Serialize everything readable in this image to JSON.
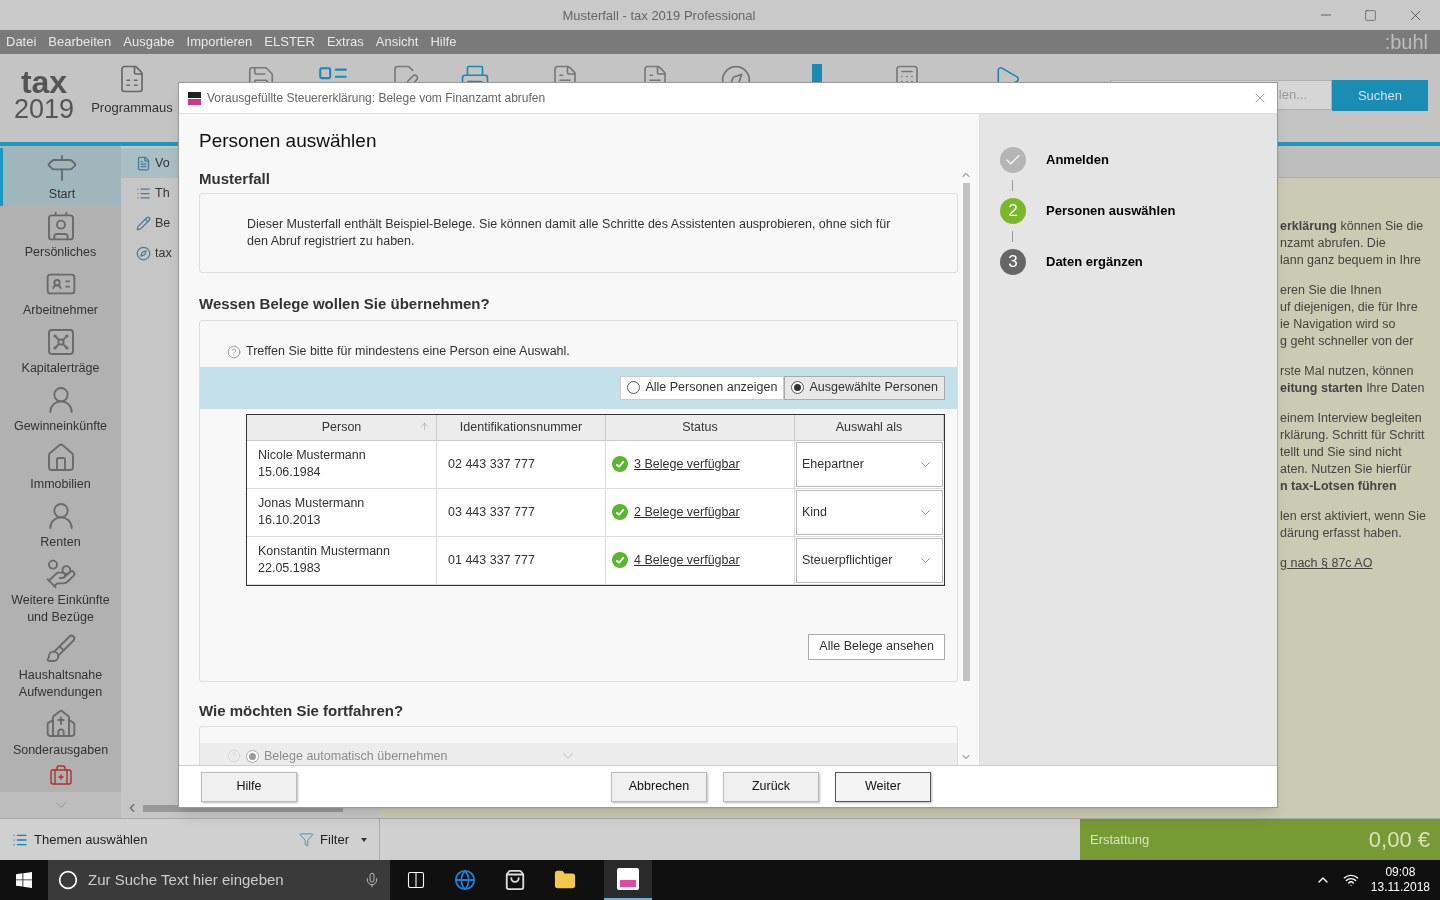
{
  "window": {
    "title": "Musterfall - tax 2019 Professional"
  },
  "menu": [
    "Datei",
    "Bearbeiten",
    "Ausgabe",
    "Importieren",
    "ELSTER",
    "Extras",
    "Ansicht",
    "Hilfe"
  ],
  "brand": ":buhl",
  "toolbar": {
    "logo_word": "tax",
    "logo_year": "2019",
    "program_label": "Programmaus",
    "search_placeholder": "len...",
    "search_button": "Suchen"
  },
  "nav": [
    {
      "label": "Start",
      "selected": true
    },
    {
      "label": "Persönliches",
      "selected": false
    },
    {
      "label": "Arbeitnehmer",
      "selected": false
    },
    {
      "label": "Kapitalerträge",
      "selected": false
    },
    {
      "label": "Gewinneinkünfte",
      "selected": false
    },
    {
      "label": "Immobilien",
      "selected": false
    },
    {
      "label": "Renten",
      "selected": false
    },
    {
      "label": "Weitere Einkünfte und Bezüge",
      "selected": false
    },
    {
      "label": "Haushaltsnahe Aufwendungen",
      "selected": false
    },
    {
      "label": "Sonderausgaben",
      "selected": false
    }
  ],
  "subnav": [
    {
      "label": "Vo",
      "selected": true
    },
    {
      "label": "Th",
      "selected": false
    },
    {
      "label": "Be",
      "selected": false
    },
    {
      "label": "tax",
      "selected": false
    }
  ],
  "info": {
    "paragraphs": [
      [
        "**erklärung** können Sie die",
        "nzamt abrufen. Die",
        "lann ganz bequem in Ihre"
      ],
      [
        "eren Sie die Ihnen",
        "uf diejenigen, die für Ihre",
        "ie Navigation wird so",
        "g geht schneller von der"
      ],
      [
        "rste Mal nutzen, können",
        "**eitung starten** Ihre Daten"
      ],
      [
        "einem Interview begleiten",
        "rklärung. Schritt für Schritt",
        "tellt und Sie sind nicht",
        "aten. Nutzen Sie hierfür",
        "**n tax-Lotsen führen**"
      ],
      [
        "len erst aktiviert, wenn Sie",
        "därung erfasst haben."
      ]
    ],
    "link": "g nach § 87c AO"
  },
  "bottom_bar": {
    "themes": "Themen auswählen",
    "filter": "Filter",
    "refund_label": "Erstattung",
    "refund_value": "0,00 €"
  },
  "dialog": {
    "title": "Vorausgefüllte Steuererklärung: Belege vom Finanzamt abrufen",
    "heading": "Personen auswählen",
    "case_title": "Musterfall",
    "case_note": "Dieser Musterfall enthält Beispiel-Belege. Sie können damit alle Schritte des Assistenten ausprobieren, ohne sich für den Abruf registriert zu haben.",
    "persons_title": "Wessen Belege wollen Sie übernehmen?",
    "persons_hint": "Treffen Sie bitte für mindestens eine Person eine Auswahl.",
    "filters": [
      {
        "label": "Alle Personen anzeigen",
        "selected": false
      },
      {
        "label": "Ausgewählte Personen",
        "selected": true
      }
    ],
    "table": {
      "columns": [
        {
          "label": "Person",
          "sorted": true
        },
        {
          "label": "Identifikationsnummer",
          "sorted": false
        },
        {
          "label": "Status",
          "sorted": false
        },
        {
          "label": "Auswahl als",
          "sorted": false
        }
      ],
      "rows": [
        {
          "name": "Nicole Mustermann",
          "birth": "15.06.1984",
          "id": "02 443 337 777",
          "status": "3 Belege verfügbar",
          "role": "Ehepartner"
        },
        {
          "name": "Jonas Mustermann",
          "birth": "16.10.2013",
          "id": "03 443 337 777",
          "status": "2 Belege verfügbar",
          "role": "Kind"
        },
        {
          "name": "Konstantin Mustermann",
          "birth": "22.05.1983",
          "id": "01 443 337 777",
          "status": "4 Belege verfügbar",
          "role": "Steuerpflichtiger"
        }
      ]
    },
    "all_docs_button": "Alle Belege ansehen",
    "continue_title": "Wie möchten Sie fortfahren?",
    "continue_option": {
      "label": "Belege automatisch übernehmen",
      "selected": true,
      "disabled": true
    },
    "steps": [
      {
        "label": "Anmelden",
        "done": true,
        "selected": false
      },
      {
        "number": "2",
        "label": "Personen auswählen",
        "done": false,
        "selected": true
      },
      {
        "number": "3",
        "label": "Daten ergänzen",
        "done": false,
        "selected": false
      }
    ],
    "buttons": [
      {
        "label": "Hilfe",
        "kind": "help"
      },
      {
        "label": "Abbrechen",
        "kind": "action"
      },
      {
        "label": "Zurück",
        "kind": "action"
      },
      {
        "label": "Weiter",
        "kind": "default"
      }
    ]
  },
  "taskbar": {
    "search_placeholder": "Zur Suche Text hier eingeben",
    "time": "09:08",
    "date": "13.11.2018"
  }
}
